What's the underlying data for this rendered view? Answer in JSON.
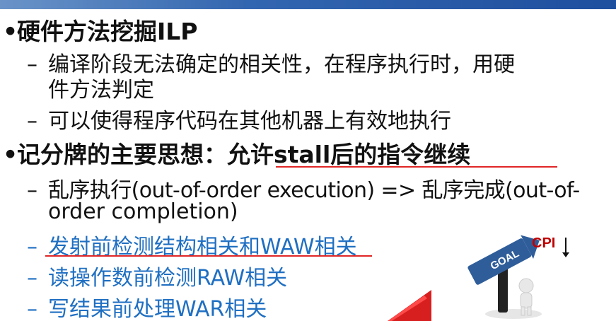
{
  "slide": {
    "bullets": [
      {
        "marker": "•",
        "text": "硬件方法挖掘ILP",
        "sub": [
          {
            "marker": "–",
            "text": "编译阶段无法确定的相关性，在程序执行时，用硬"
          },
          {
            "marker": "",
            "text": "件方法判定"
          },
          {
            "marker": "–",
            "text": "可以使得程序代码在其他机器上有效地执行"
          }
        ]
      },
      {
        "marker": "•",
        "text": "记分牌的主要思想：允许stall后的指令继续",
        "sub": [
          {
            "marker": "–",
            "text": "乱序执行(out-of-order execution) => 乱序完成(out-of-"
          },
          {
            "marker": "",
            "text": "order completion)"
          },
          {
            "marker": "–",
            "text": "发射前检测结构相关和WAW相关"
          },
          {
            "marker": "–",
            "text": "读操作数前检测RAW相关"
          },
          {
            "marker": "–",
            "text": "写结果前处理WAR相关"
          }
        ]
      }
    ]
  },
  "figure": {
    "cpi_label": "CPI",
    "goal_label": "GOAL"
  },
  "colors": {
    "text": "#111111",
    "blue_text": "#1f6fc2",
    "underline": "#e02626",
    "top_bar": "#1e4f9f"
  }
}
